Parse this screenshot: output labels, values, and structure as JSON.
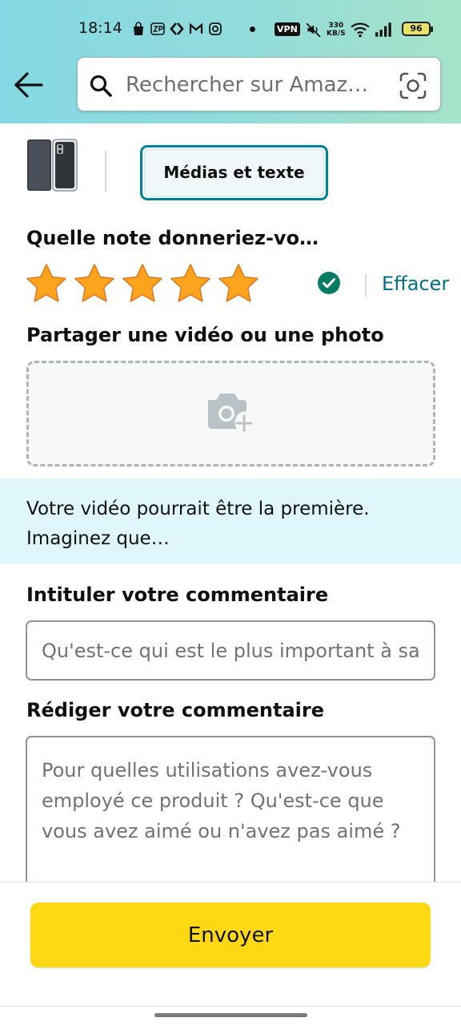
{
  "status_bar": {
    "time": "18:14",
    "vpn": "VPN",
    "net_speed_value": "330",
    "net_speed_unit": "KB/S",
    "battery": "96"
  },
  "search": {
    "placeholder": "Rechercher sur Amaz…"
  },
  "tabs": {
    "media_text": "Médias et texte"
  },
  "rating": {
    "question": "Quelle note donneriez-vo…",
    "stars_selected": 5,
    "stars_total": 5,
    "clear_label": "Effacer"
  },
  "media": {
    "title": "Partager une vidéo ou une photo"
  },
  "banner": {
    "line1": "Votre vidéo pourrait être la première.",
    "line2": "Imaginez que…"
  },
  "review_title": {
    "label": "Intituler votre commentaire",
    "placeholder": "Qu'est-ce qui est le plus important à savoir ?"
  },
  "review_body": {
    "label": "Rédiger votre commentaire",
    "placeholder": "Pour quelles utilisations avez-vous employé ce produit ? Qu'est-ce que vous avez aimé ou n'avez pas aimé ?"
  },
  "actions": {
    "submit_label": "Envoyer"
  },
  "colors": {
    "accent": "#007185",
    "tab_border": "#008296",
    "button": "#ffd814",
    "star": "#ffa41c",
    "check": "#067d62",
    "banner": "#dff7fb"
  }
}
